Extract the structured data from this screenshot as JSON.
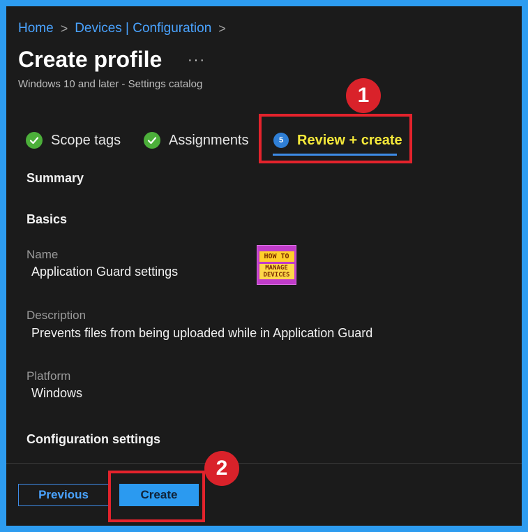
{
  "breadcrumb": {
    "items": [
      "Home",
      "Devices | Configuration"
    ],
    "separator": ">"
  },
  "header": {
    "title": "Create profile",
    "more_label": "···",
    "subtitle": "Windows 10 and later - Settings catalog"
  },
  "tabs": [
    {
      "label": "Scope tags",
      "state": "completed",
      "icon": "check-icon"
    },
    {
      "label": "Assignments",
      "state": "completed",
      "icon": "check-icon"
    },
    {
      "label": "Review + create",
      "state": "active",
      "icon": "step-icon",
      "step": "5"
    }
  ],
  "annotations": [
    "1",
    "2"
  ],
  "summary": {
    "heading": "Summary",
    "basics_heading": "Basics",
    "fields": [
      {
        "label": "Name",
        "value": "Application Guard settings"
      },
      {
        "label": "Description",
        "value": "Prevents files from being uploaded while in Application Guard"
      },
      {
        "label": "Platform",
        "value": "Windows"
      }
    ],
    "config_heading": "Configuration settings"
  },
  "logo": {
    "line1": "HOW TO",
    "line2": "MANAGE",
    "line3": "DEVICES"
  },
  "footer": {
    "previous_label": "Previous",
    "create_label": "Create"
  },
  "colors": {
    "frame": "#2d9cf0",
    "background": "#1b1b1b",
    "link": "#4aa3ff",
    "active_tab": "#f4e83a",
    "annotation": "#e3232c",
    "primary_button": "#2b9af0"
  }
}
